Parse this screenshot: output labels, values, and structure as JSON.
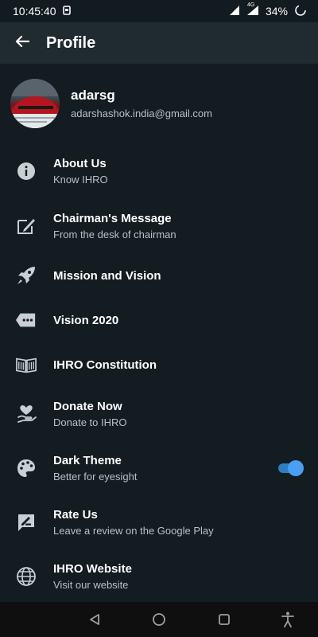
{
  "status_bar": {
    "time": "10:45:40",
    "network": "4G",
    "battery": "34%",
    "icons": [
      "notification-icon",
      "wifi-signal-icon",
      "cell-signal-icon",
      "battery-icon"
    ]
  },
  "app_bar": {
    "title": "Profile",
    "back_icon": "arrow-left-icon"
  },
  "profile": {
    "name": "adarsg",
    "email": "adarshashok.india@gmail.com"
  },
  "menu": {
    "items": [
      {
        "title": "About Us",
        "subtitle": "Know IHRO",
        "icon": "info-icon"
      },
      {
        "title": "Chairman's Message",
        "subtitle": "From the desk of chairman",
        "icon": "sign-pen-icon"
      },
      {
        "title": "Mission and Vision",
        "subtitle": "",
        "icon": "rocket-icon"
      },
      {
        "title": "Vision 2020",
        "subtitle": "",
        "icon": "ellipsis-tag-icon"
      },
      {
        "title": "IHRO Constitution",
        "subtitle": "",
        "icon": "book-icon"
      },
      {
        "title": "Donate Now",
        "subtitle": "Donate to IHRO",
        "icon": "donate-heart-icon"
      },
      {
        "title": "Dark Theme",
        "subtitle": "Better for eyesight",
        "icon": "palette-icon",
        "toggle_on": true
      },
      {
        "title": "Rate Us",
        "subtitle": "Leave a review on the Google Play",
        "icon": "rate-review-icon"
      },
      {
        "title": "IHRO Website",
        "subtitle": "Visit our website",
        "icon": "globe-icon"
      }
    ]
  },
  "colors": {
    "background": "#131c21",
    "app_bar": "#1f2a31",
    "accent": "#4a9ff0",
    "subtitle": "#b8c0c5"
  },
  "nav_bar": {
    "icons": [
      "back-triangle-icon",
      "home-circle-icon",
      "recents-square-icon",
      "accessibility-icon"
    ]
  }
}
